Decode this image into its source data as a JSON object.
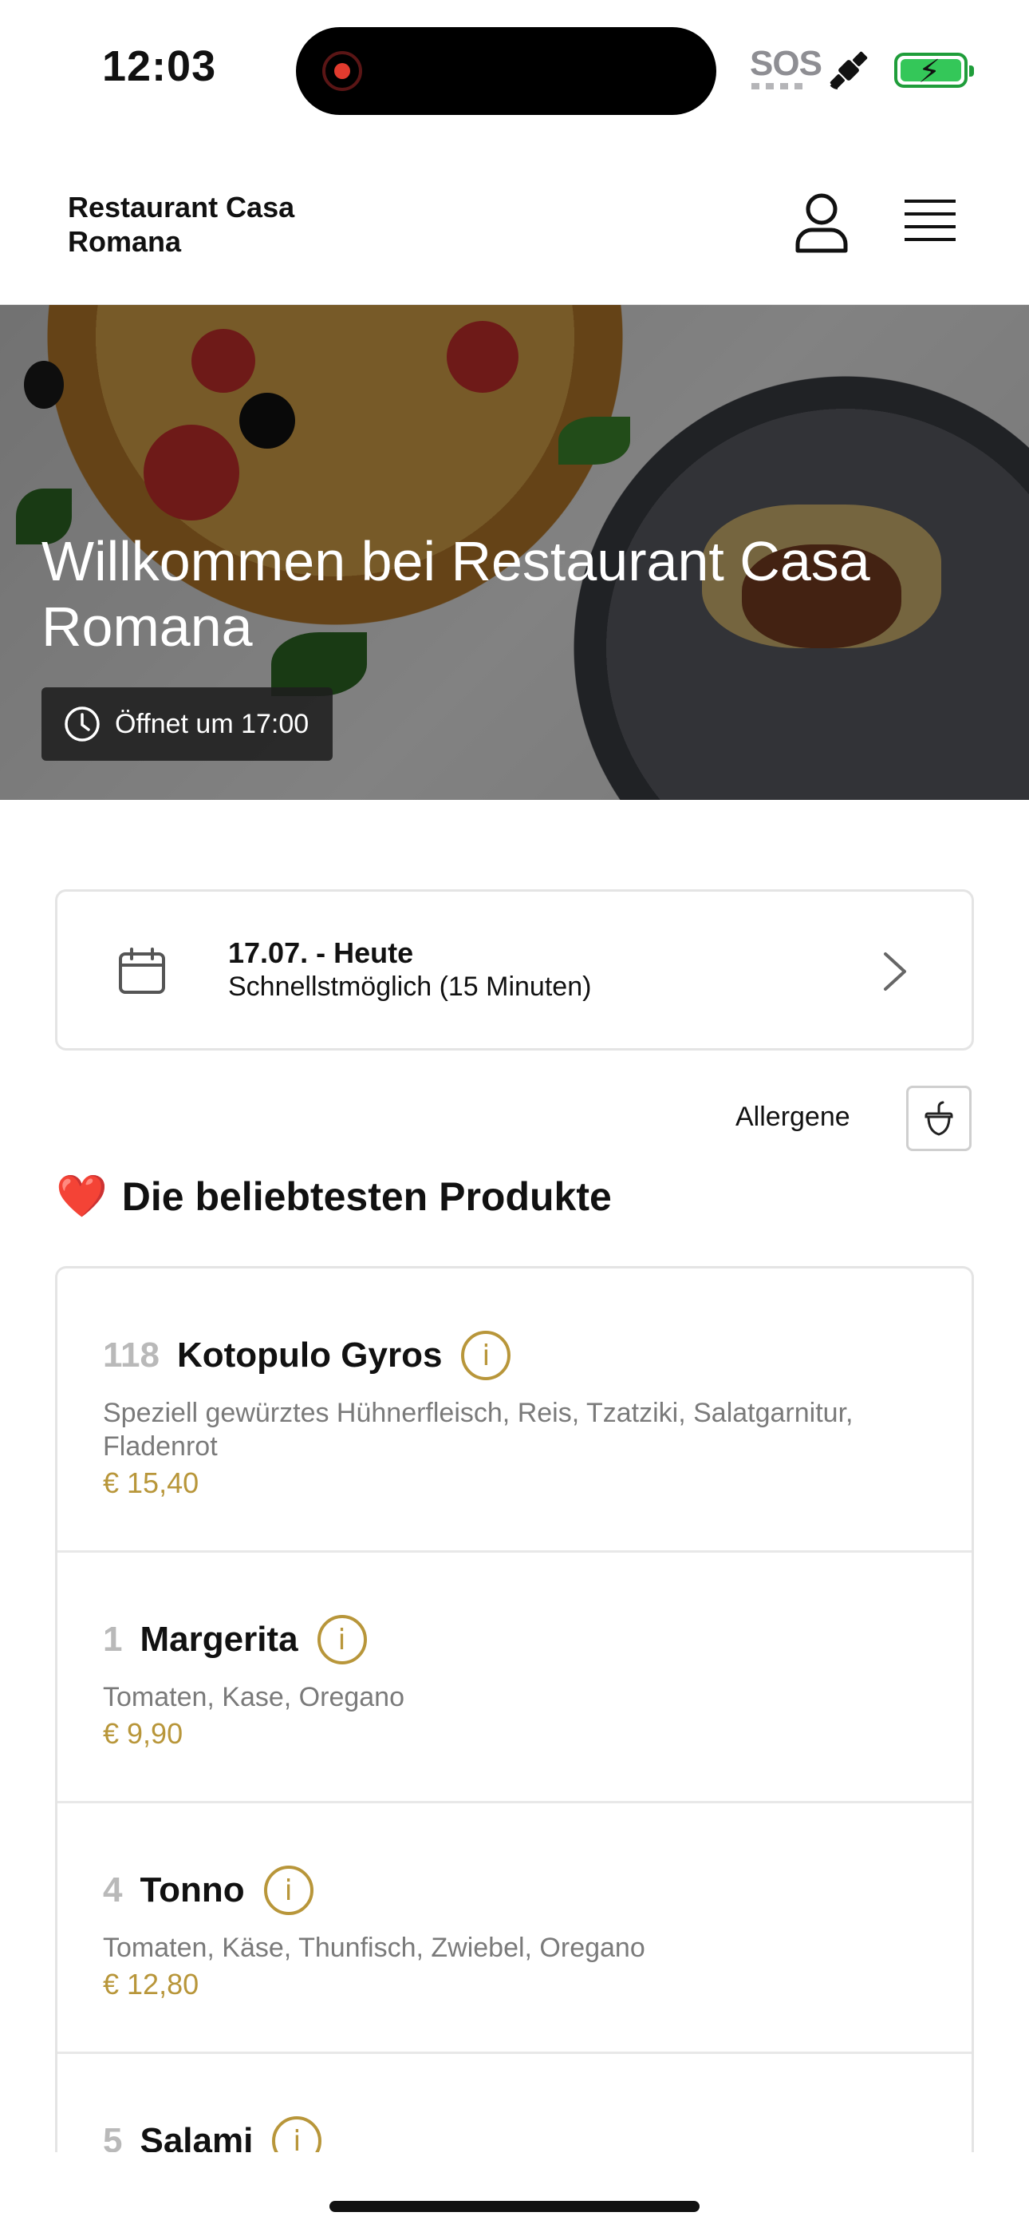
{
  "status_bar": {
    "time": "12:03",
    "sos": "SOS",
    "icons": [
      "recording-indicator",
      "satellite-icon",
      "battery-charging-icon"
    ],
    "battery_color": "#34c759"
  },
  "header": {
    "brand": "Restaurant Casa Romana",
    "icons": [
      "user-icon",
      "hamburger-menu-icon"
    ]
  },
  "hero": {
    "title": "Willkommen bei Restaurant Casa Romana",
    "opening_badge": "Öffnet um 17:00"
  },
  "order_time": {
    "date": "17.07. - Heute",
    "slot": "Schnellstmöglich (15 Minuten)"
  },
  "allergens": {
    "label": "Allergene"
  },
  "popular": {
    "emoji": "❤️",
    "title": "Die beliebtesten Produkte",
    "products": [
      {
        "num": "118",
        "name": "Kotopulo Gyros",
        "desc": "Speziell gewürztes Hühnerfleisch, Reis, Tzatziki, Salatgarnitur, Fladenrot",
        "price": "€ 15,40"
      },
      {
        "num": "1",
        "name": "Margerita",
        "desc": "Tomaten, Kase, Oregano",
        "price": "€ 9,90"
      },
      {
        "num": "4",
        "name": "Tonno",
        "desc": "Tomaten, Käse, Thunfisch, Zwiebel, Oregano",
        "price": "€ 12,80"
      },
      {
        "num": "5",
        "name": "Salami",
        "desc": "",
        "price": ""
      }
    ]
  },
  "colors": {
    "accent_gold": "#b8963a",
    "text_dark": "#111111",
    "muted": "#7a7a7a"
  }
}
